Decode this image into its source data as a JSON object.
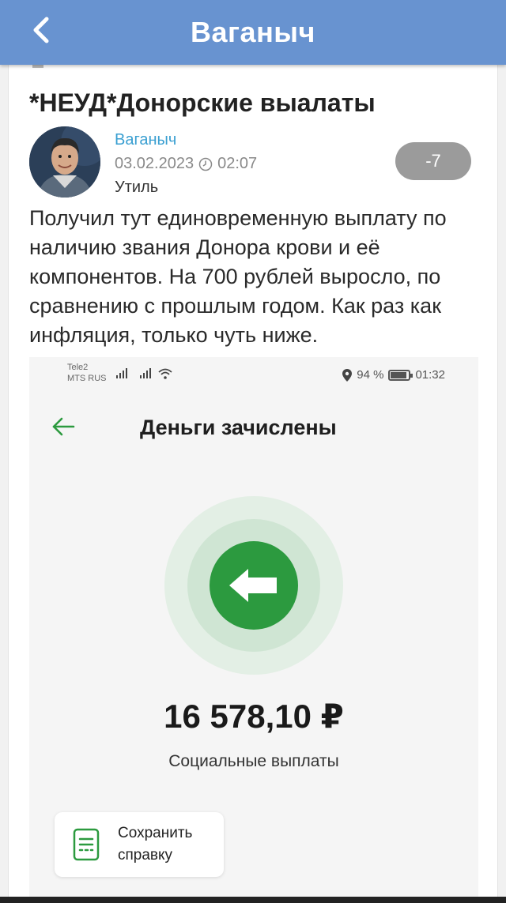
{
  "header": {
    "title": "Ваганыч",
    "back_icon": "chevron-left-icon"
  },
  "post": {
    "title": "*НЕУД*Донорские выалаты",
    "author": "Ваганыч",
    "date": "03.02.2023",
    "time": "02:07",
    "category": "Утиль",
    "rating": "-7",
    "body": "Получил тут единовременную выплату по наличию звания Донора крови и её компонентов. На 700 рублей выросло, по сравнению с прошлым годом. Как раз как инфляция, только чуть ниже."
  },
  "screenshot": {
    "status_bar": {
      "carrier1": "Tele2",
      "carrier2": "MTS RUS",
      "battery": "94 %",
      "time": "01:32"
    },
    "title": "Деньги зачислены",
    "amount": "16 578,10 ₽",
    "amount_label": "Социальные выплаты",
    "save_button": {
      "line1": "Сохранить",
      "line2": "справку"
    }
  },
  "colors": {
    "header_bg": "#6893d0",
    "author_link": "#3a9fd1",
    "rating_bg": "#9b9b9b",
    "accent_green": "#2c9a3f"
  }
}
